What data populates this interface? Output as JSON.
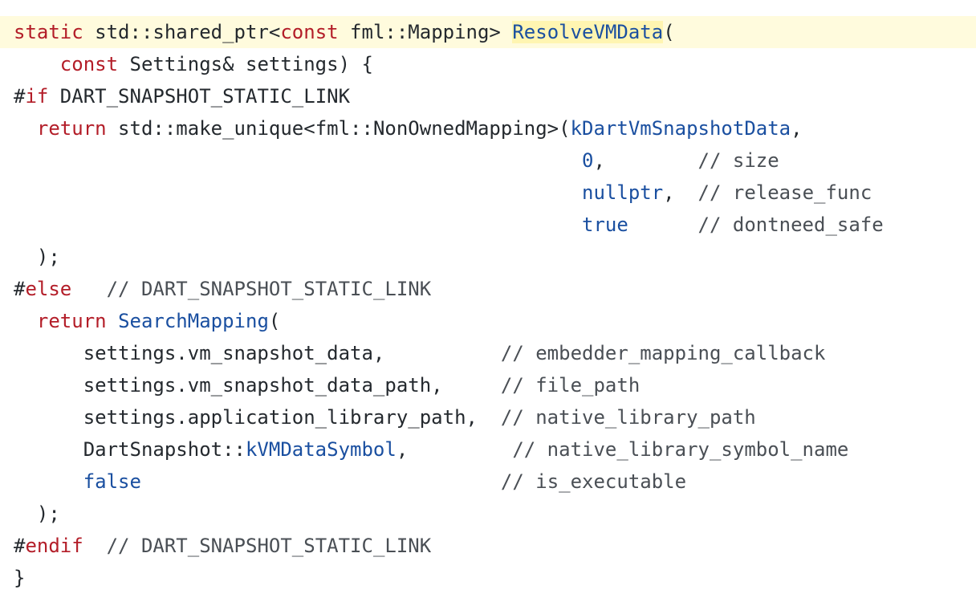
{
  "colors": {
    "keyword": "#b31d28",
    "function": "#1a4fa0",
    "comment": "#4a4f55",
    "plain": "#24292e",
    "highlight_line": "#fffbdd",
    "highlight_token": "#fff5b1"
  },
  "code": {
    "language": "C++",
    "lines": [
      {
        "name": "line-01",
        "highlight": true,
        "tokens": [
          {
            "t": "static",
            "c": "kw"
          },
          {
            "t": " std::shared_ptr<",
            "c": "pl"
          },
          {
            "t": "const",
            "c": "kw"
          },
          {
            "t": " fml::Mapping> ",
            "c": "pl"
          },
          {
            "t": "ResolveVMData",
            "c": "fn",
            "mark": true
          },
          {
            "t": "(",
            "c": "pl"
          }
        ]
      },
      {
        "name": "line-02",
        "tokens": [
          {
            "t": "    ",
            "c": "pl"
          },
          {
            "t": "const",
            "c": "kw"
          },
          {
            "t": " Settings& settings) {",
            "c": "pl"
          }
        ]
      },
      {
        "name": "line-03",
        "tokens": [
          {
            "t": "#",
            "c": "pl"
          },
          {
            "t": "if",
            "c": "kw"
          },
          {
            "t": " DART_SNAPSHOT_STATIC_LINK",
            "c": "pl"
          }
        ]
      },
      {
        "name": "line-04",
        "tokens": [
          {
            "t": "  ",
            "c": "pl"
          },
          {
            "t": "return",
            "c": "kw"
          },
          {
            "t": " std::make_unique<fml::NonOwnedMapping>(",
            "c": "pl"
          },
          {
            "t": "kDartVmSnapshotData",
            "c": "fn"
          },
          {
            "t": ",",
            "c": "pl"
          }
        ]
      },
      {
        "name": "line-05",
        "tokens": [
          {
            "t": "                                                 ",
            "c": "pl"
          },
          {
            "t": "0",
            "c": "fn"
          },
          {
            "t": ",        ",
            "c": "pl"
          },
          {
            "t": "// size",
            "c": "cm"
          }
        ]
      },
      {
        "name": "line-06",
        "tokens": [
          {
            "t": "                                                 ",
            "c": "pl"
          },
          {
            "t": "nullptr",
            "c": "fn"
          },
          {
            "t": ",  ",
            "c": "pl"
          },
          {
            "t": "// release_func",
            "c": "cm"
          }
        ]
      },
      {
        "name": "line-07",
        "tokens": [
          {
            "t": "                                                 ",
            "c": "pl"
          },
          {
            "t": "true",
            "c": "fn"
          },
          {
            "t": "      ",
            "c": "pl"
          },
          {
            "t": "// dontneed_safe",
            "c": "cm"
          }
        ]
      },
      {
        "name": "line-08",
        "tokens": [
          {
            "t": "  );",
            "c": "pl"
          }
        ]
      },
      {
        "name": "line-09",
        "tokens": [
          {
            "t": "#",
            "c": "pl"
          },
          {
            "t": "else",
            "c": "kw"
          },
          {
            "t": "   ",
            "c": "pl"
          },
          {
            "t": "// DART_SNAPSHOT_STATIC_LINK",
            "c": "cm"
          }
        ]
      },
      {
        "name": "line-10",
        "tokens": [
          {
            "t": "  ",
            "c": "pl"
          },
          {
            "t": "return",
            "c": "kw"
          },
          {
            "t": " ",
            "c": "pl"
          },
          {
            "t": "SearchMapping",
            "c": "fn"
          },
          {
            "t": "(",
            "c": "pl"
          }
        ]
      },
      {
        "name": "line-11",
        "tokens": [
          {
            "t": "      settings.vm_snapshot_data,          ",
            "c": "pl"
          },
          {
            "t": "// embedder_mapping_callback",
            "c": "cm"
          }
        ]
      },
      {
        "name": "line-12",
        "tokens": [
          {
            "t": "      settings.vm_snapshot_data_path,     ",
            "c": "pl"
          },
          {
            "t": "// file_path",
            "c": "cm"
          }
        ]
      },
      {
        "name": "line-13",
        "tokens": [
          {
            "t": "      settings.application_library_path,  ",
            "c": "pl"
          },
          {
            "t": "// native_library_path",
            "c": "cm"
          }
        ]
      },
      {
        "name": "line-14",
        "tokens": [
          {
            "t": "      DartSnapshot::",
            "c": "pl"
          },
          {
            "t": "kVMDataSymbol",
            "c": "fn"
          },
          {
            "t": ",         ",
            "c": "pl"
          },
          {
            "t": "// native_library_symbol_name",
            "c": "cm"
          }
        ]
      },
      {
        "name": "line-15",
        "tokens": [
          {
            "t": "      ",
            "c": "pl"
          },
          {
            "t": "false",
            "c": "fn"
          },
          {
            "t": "                               ",
            "c": "pl"
          },
          {
            "t": "// is_executable",
            "c": "cm"
          }
        ]
      },
      {
        "name": "line-16",
        "tokens": [
          {
            "t": "  );",
            "c": "pl"
          }
        ]
      },
      {
        "name": "line-17",
        "tokens": [
          {
            "t": "#",
            "c": "pl"
          },
          {
            "t": "endif",
            "c": "kw"
          },
          {
            "t": "  ",
            "c": "pl"
          },
          {
            "t": "// DART_SNAPSHOT_STATIC_LINK",
            "c": "cm"
          }
        ]
      },
      {
        "name": "line-18",
        "tokens": [
          {
            "t": "}",
            "c": "pl"
          }
        ]
      }
    ]
  }
}
